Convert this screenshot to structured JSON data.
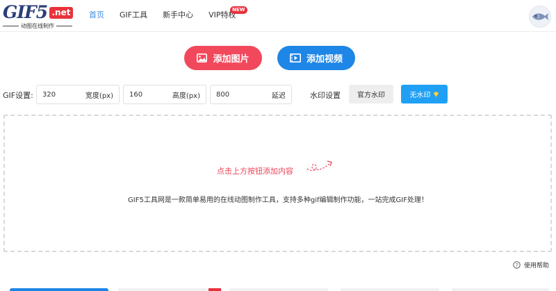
{
  "header": {
    "logo": {
      "main": "GIF5",
      "badge": ".net",
      "subtitle": "动图在线制作"
    },
    "nav": [
      {
        "label": "首页",
        "active": true
      },
      {
        "label": "GIF工具",
        "active": false
      },
      {
        "label": "新手中心",
        "active": false
      },
      {
        "label": "VIP特权",
        "active": false,
        "badge": "NEW"
      }
    ],
    "avatar_icon": "fish-avatar-icon"
  },
  "actions": {
    "add_image": "添加图片",
    "add_video": "添加视频"
  },
  "settings": {
    "gif_label": "GIF设置:",
    "width": {
      "value": "320",
      "unit": "宽度(px)"
    },
    "height": {
      "value": "160",
      "unit": "高度(px)"
    },
    "delay": {
      "value": "800",
      "unit": "延迟"
    },
    "watermark_label": "水印设置",
    "watermark_official": "官方水印",
    "watermark_none": "无水印"
  },
  "dropzone": {
    "hint": "点击上方按钮添加内容",
    "description": "GIF5工具网是一款简单易用的在线动图制作工具，支持多种gif编辑制作功能，一站完成GIF处理！"
  },
  "help": {
    "label": "使用帮助"
  },
  "colors": {
    "nav_active": "#3a8be0",
    "add_image_bg": "#f2485c",
    "add_video_bg": "#1e86e6",
    "watermark_none_bg": "#20a0f4",
    "hint": "#e8455a",
    "brand_red": "#e8323c",
    "brand_navy": "#2a3f77"
  }
}
